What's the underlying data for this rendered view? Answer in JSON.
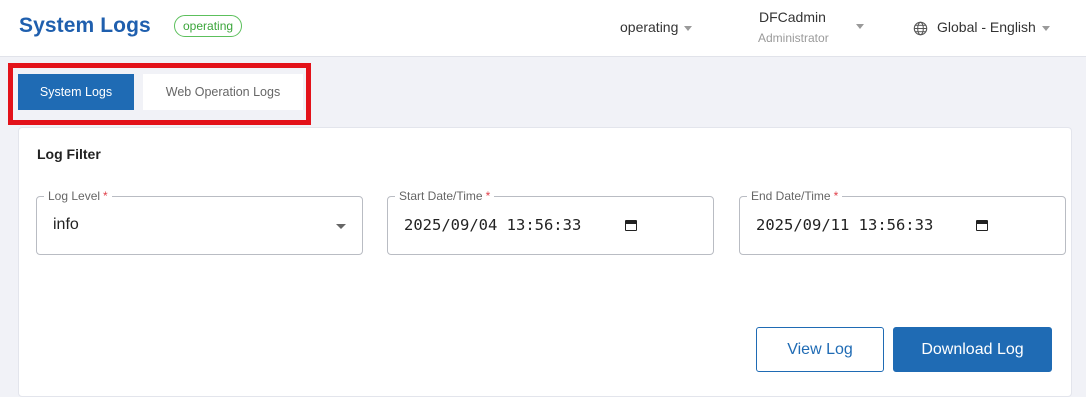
{
  "header": {
    "title": "System Logs",
    "status_badge": "operating",
    "mode_select": "operating",
    "user": {
      "name": "DFCadmin",
      "role": "Administrator"
    },
    "language": "Global - English"
  },
  "tabs": [
    {
      "label": "System Logs",
      "active": true
    },
    {
      "label": "Web Operation Logs",
      "active": false
    }
  ],
  "filter": {
    "title": "Log Filter",
    "required_mark": "*",
    "log_level": {
      "label": "Log Level",
      "value": "info"
    },
    "start": {
      "label": "Start Date/Time",
      "value": "2025/09/04 13:56:33"
    },
    "end": {
      "label": "End Date/Time",
      "value": "2025/09/11 13:56:33"
    }
  },
  "buttons": {
    "view": "View Log",
    "download": "Download Log"
  },
  "colors": {
    "brand": "#1f6bb4",
    "status_green": "#3aa53a",
    "highlight_red": "#e3121a",
    "required_red": "#e0404a"
  },
  "icons": [
    "caret-down-icon",
    "globe-icon",
    "calendar-icon"
  ]
}
